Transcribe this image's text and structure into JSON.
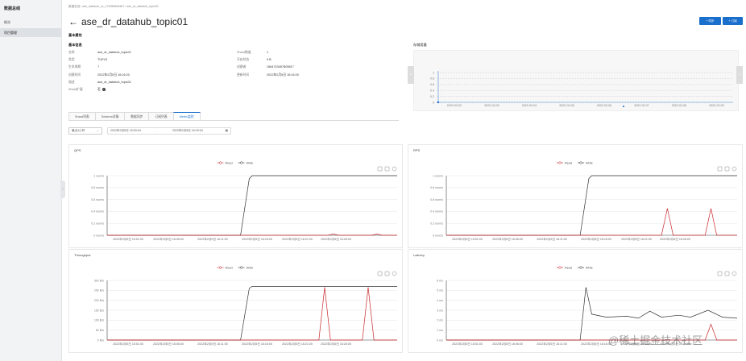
{
  "sidebar": {
    "title": "数据总线",
    "items": [
      {
        "label": "概览"
      },
      {
        "label": "项目管理"
      }
    ]
  },
  "header": {
    "breadcrumb": "数据总线 / ase_datahub_ra_172558508487 / ase_dr_datahub_topic01",
    "title": "ase_dr_datahub_topic01",
    "btn_sync": "+ 同步",
    "btn_subscribe": "+ 订阅"
  },
  "basic": {
    "section": "基本属性",
    "subsection": "基本信息",
    "rows": [
      {
        "k1": "名称",
        "v1": "ase_dr_datahub_topic01",
        "k2": "Shard数量",
        "v2": "1"
      },
      {
        "k1": "类型",
        "v1": "TUPLE",
        "k2": "开启状态",
        "v2": "0 B"
      },
      {
        "k1": "生命周期",
        "v1": "7",
        "k2": "创建者",
        "v2": "1564743497809817"
      },
      {
        "k1": "创建时间",
        "v1": "2022年2月5日 16:16:20",
        "k2": "更新时间",
        "v2": "2022年2月5日 16:16:20"
      },
      {
        "k1": "描述",
        "v1": "ase_dr_datahub_topic01",
        "k2": "",
        "v2": ""
      },
      {
        "k1": "Shard扩展",
        "v1": "否",
        "k2": "",
        "v2": ""
      }
    ]
  },
  "storage": {
    "title": "存储用量",
    "dates": [
      "2022-02-02",
      "2022-02-03",
      "2022-02-04",
      "2022-02-05",
      "2022-02-06",
      "2022-02-07",
      "2022-02-08",
      "2022-02-09"
    ],
    "yticks": [
      "1",
      "0.8",
      "0.6",
      "0.4",
      "0.2",
      "0"
    ]
  },
  "tabs": [
    {
      "label": "Shard列表"
    },
    {
      "label": "Schema详情"
    },
    {
      "label": "数据同步"
    },
    {
      "label": "订阅列表"
    },
    {
      "label": "Metric监控"
    }
  ],
  "filter": {
    "range": "最近1小时",
    "start": "2022年2月5日 15:53:04",
    "end": "2022年2月5日 16:23:04"
  },
  "charts": [
    {
      "title": "QPS",
      "legend": [
        "Read",
        "Write"
      ],
      "yticks": [
        "1 num/s",
        "0.8 num/s",
        "0.6 num/s",
        "0.4 num/s",
        "0.2 num/s",
        "0 num/s"
      ],
      "xticks": [
        "2022年2月5日 15:51:00",
        "2022年2月5日 16:06:00",
        "2022年2月5日 16:11:00",
        "2022年2月5日 16:16:00",
        "2022年2月5日 16:21:00",
        "2022年2月5日 16:26:00"
      ]
    },
    {
      "title": "RPS",
      "legend": [
        "Read",
        "Write"
      ],
      "yticks": [
        "1 num/s",
        "0.8 num/s",
        "0.6 num/s",
        "0.4 num/s",
        "0.2 num/s",
        "0 num/s"
      ],
      "xticks": [
        "2022年2月5日 15:51:00",
        "2022年2月5日 16:06:00",
        "2022年2月5日 16:11:00",
        "2022年2月5日 16:16:00",
        "2022年2月5日 16:21:00",
        "2022年2月5日 16:26:00"
      ]
    },
    {
      "title": "Throughput",
      "legend": [
        "Read",
        "Write"
      ],
      "yticks": [
        "300 B/s",
        "250 B/s",
        "200 B/s",
        "150 B/s",
        "100 B/s",
        "50 B/s",
        "0 B/s"
      ],
      "xticks": [
        "2022年2月5日 15:51:00",
        "2022年2月5日 16:06:00",
        "2022年2月5日 16:11:00",
        "2022年2月5日 16:16:00",
        "2022年2月5日 16:21:00",
        "2022年2月5日 16:26:00"
      ]
    },
    {
      "title": "Latency",
      "legend": [
        "Read",
        "Write"
      ],
      "yticks": [
        "6 ms",
        "5 ms",
        "4 ms",
        "3 ms",
        "2 ms",
        "1 ms",
        "0 ms"
      ],
      "xticks": [
        "2022年2月5日 15:51:00",
        "2022年2月5日 16:06:00",
        "2022年2月5日 16:11:00",
        "2022年2月5日 16:16:00",
        "2022年2月5日 16:21:00",
        "2022年2月5日 16:26:00"
      ]
    }
  ],
  "colors": {
    "read": "#c8282d",
    "write": "#333333",
    "accent": "#1a6fcc"
  },
  "icons": [
    "back-arrow-icon",
    "calendar-icon",
    "chevron-down-icon",
    "chevron-left-icon",
    "chevron-right-icon",
    "help-icon",
    "chart-tool-icons"
  ],
  "watermark": "@稀土掘金技术社区"
}
